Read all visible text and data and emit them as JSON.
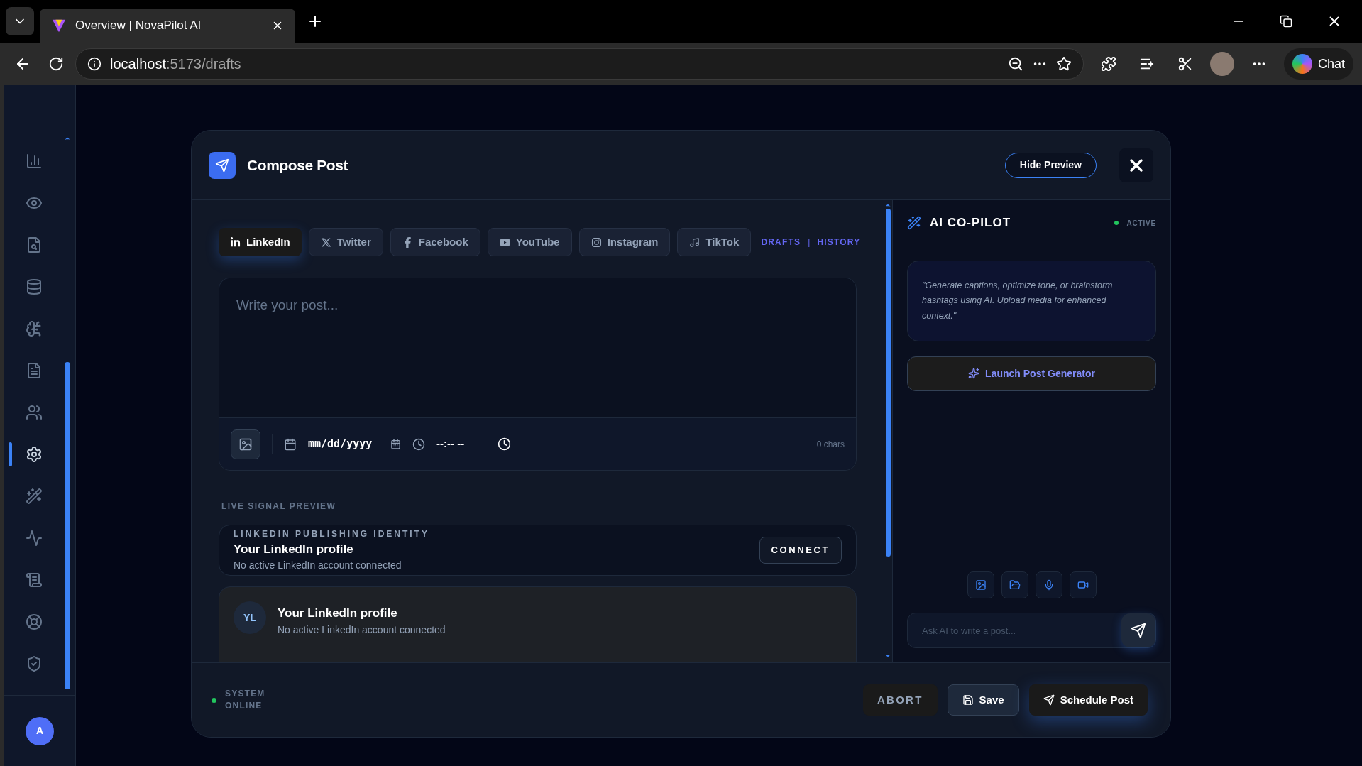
{
  "browser": {
    "tab_title": "Overview | NovaPilot AI",
    "url_host": "localhost",
    "url_path": ":5173/drafts",
    "chat_label": "Chat"
  },
  "sidebar": {
    "items": [
      {
        "selected": false
      },
      {
        "selected": false
      },
      {
        "selected": false
      },
      {
        "selected": false
      },
      {
        "selected": false
      },
      {
        "selected": false
      },
      {
        "selected": false
      },
      {
        "selected": true
      },
      {
        "selected": false
      },
      {
        "selected": false
      },
      {
        "selected": false
      },
      {
        "selected": false
      },
      {
        "selected": false
      }
    ],
    "avatar": "A"
  },
  "modal": {
    "title": "Compose Post",
    "hide_preview": "Hide Preview",
    "platform_tabs": [
      {
        "label": "LinkedIn",
        "kind": "linkedin",
        "selected": true
      },
      {
        "label": "Twitter",
        "kind": "x",
        "selected": false
      },
      {
        "label": "Facebook",
        "kind": "facebook",
        "selected": false
      },
      {
        "label": "YouTube",
        "kind": "youtube",
        "selected": false
      },
      {
        "label": "Instagram",
        "kind": "instagram",
        "selected": false
      },
      {
        "label": "TikTok",
        "kind": "tiktok",
        "selected": false
      }
    ],
    "links": [
      "DRAFTS",
      "HISTORY"
    ],
    "link_separator": "|",
    "editor": {
      "placeholder": "Write your post...",
      "date_placeholder": "mm/dd/yyyy",
      "time_placeholder": "--:-- --",
      "char_count": "0 chars"
    },
    "preview_label": "LIVE SIGNAL PREVIEW",
    "identity": {
      "eyebrow": "LINKEDIN PUBLISHING IDENTITY",
      "name": "Your LinkedIn profile",
      "status": "No active LinkedIn account connected",
      "button": "CONNECT"
    },
    "preview_card": {
      "initials": "YL",
      "name": "Your LinkedIn profile",
      "status": "No active LinkedIn account connected"
    },
    "copilot": {
      "title": "AI CO-PILOT",
      "status": "ACTIVE",
      "online": true,
      "hint": "\"Generate captions, optimize tone, or brainstorm hashtags using AI. Upload media for enhanced context.\"",
      "launch": "Launch Post Generator",
      "input_placeholder": "Ask AI to write a post..."
    },
    "footer": {
      "status_lines": [
        "SYSTEM",
        "ONLINE"
      ],
      "online": true,
      "buttons": [
        {
          "label": "ABORT",
          "kind": "abort"
        },
        {
          "label": "Save",
          "kind": "save"
        },
        {
          "label": "Schedule Post",
          "kind": "schedule"
        }
      ]
    }
  }
}
